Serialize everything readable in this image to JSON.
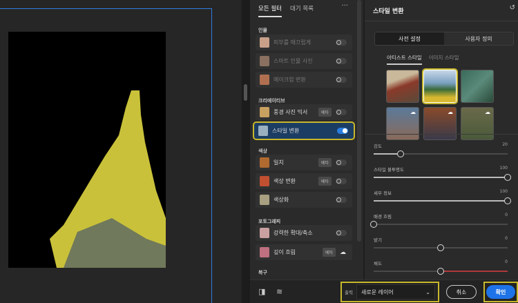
{
  "tabs": {
    "all_filters": "모든 필터",
    "waitlist": "대기 목록",
    "more": "···"
  },
  "sections": {
    "portrait": "인물",
    "creative": "크리에이티브",
    "color": "색상",
    "photography": "포토그래피",
    "restore": "복구"
  },
  "beta_label": "베타",
  "filters": [
    {
      "label": "피부를 매끄럽게",
      "enabled": false,
      "disabled": true
    },
    {
      "label": "스마트 인물 사진",
      "enabled": false,
      "disabled": true
    },
    {
      "label": "메이크업 변환",
      "enabled": false,
      "disabled": true
    },
    {
      "label": "풍경 사진 믹서",
      "beta": true,
      "enabled": false
    },
    {
      "label": "스타일 변환",
      "enabled": true,
      "selected": true
    },
    {
      "label": "일치",
      "beta": true,
      "enabled": false
    },
    {
      "label": "색상 변환",
      "beta": true,
      "enabled": false
    },
    {
      "label": "색상화",
      "enabled": false
    },
    {
      "label": "강력한 확대/축소",
      "enabled": false
    },
    {
      "label": "깊이 흐림",
      "beta": true,
      "download": true
    }
  ],
  "panel": {
    "title": "스타일 변환",
    "segments": [
      "사전 설정",
      "사용자 정의"
    ],
    "style_tabs": [
      "아티스트 스타일",
      "이미지 스타일"
    ],
    "sliders": [
      {
        "label": "강도",
        "value": 20,
        "fraction": 0.2
      },
      {
        "label": "스타일 불투명도",
        "value": 100,
        "fraction": 1
      },
      {
        "label": "세부 정보",
        "value": 100,
        "fraction": 1
      },
      {
        "label": "배경 흐림",
        "value": 0,
        "fraction": 0
      },
      {
        "label": "밝기",
        "value": 0,
        "fraction": 0.5
      },
      {
        "label": "채도",
        "value": 0,
        "fraction": 0.5
      }
    ]
  },
  "bottom": {
    "output_label": "출력",
    "output_value": "새로운 레이어",
    "cancel": "취소",
    "ok": "확인"
  },
  "colors": {
    "accent": "#1f73e8",
    "highlight": "#c8b82c"
  }
}
